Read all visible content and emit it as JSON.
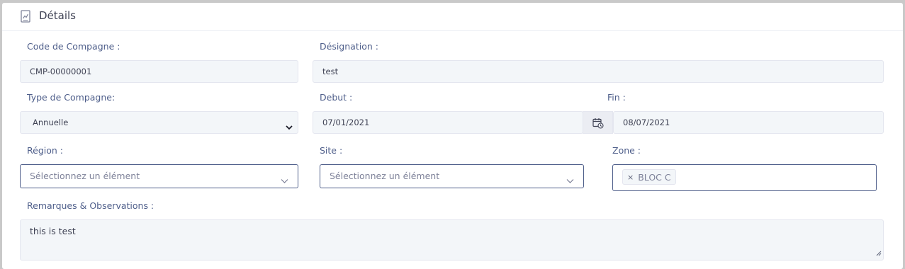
{
  "header": {
    "title": "Détails",
    "icon": "report-icon"
  },
  "form": {
    "code": {
      "label": "Code de Compagne :",
      "value": "CMP-00000001"
    },
    "designation": {
      "label": "Désignation :",
      "value": "test"
    },
    "type": {
      "label": "Type de Compagne:",
      "selected": "Annuelle"
    },
    "debut": {
      "label": "Debut :",
      "value": "07/01/2021"
    },
    "fin": {
      "label": "Fin :",
      "value": "08/07/2021"
    },
    "region": {
      "label": "Région :",
      "placeholder": "Sélectionnez un élément"
    },
    "site": {
      "label": "Site :",
      "placeholder": "Sélectionnez un élément"
    },
    "zone": {
      "label": "Zone :",
      "tag": "BLOC C",
      "remove_glyph": "×"
    },
    "remarks": {
      "label": "Remarques & Observations :",
      "value": "this is test"
    }
  },
  "colors": {
    "label": "#4e5e8a",
    "field_bg": "#f3f6f9",
    "select_border": "#4e5e8a",
    "card_bg": "#ffffff",
    "page_bg": "#c9c9c9"
  }
}
